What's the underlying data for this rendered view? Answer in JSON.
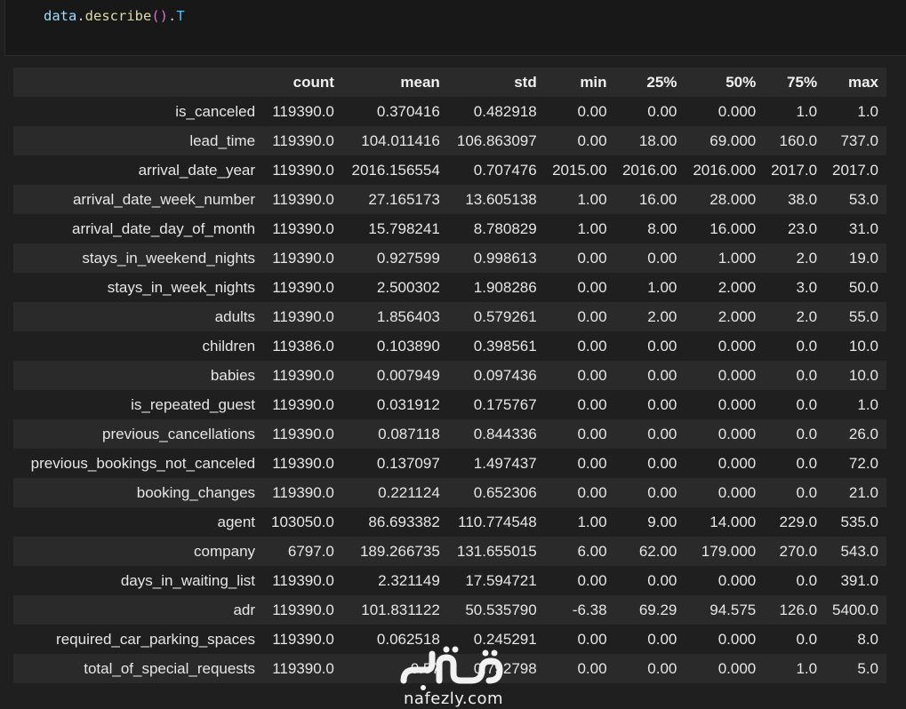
{
  "code_cell": {
    "obj": "data",
    "dot1": ".",
    "method": "describe",
    "parens": "()",
    "dot2": ".",
    "attr": "T"
  },
  "table": {
    "columns": [
      "",
      "count",
      "mean",
      "std",
      "min",
      "25%",
      "50%",
      "75%",
      "max"
    ],
    "rows": [
      [
        "is_canceled",
        "119390.0",
        "0.370416",
        "0.482918",
        "0.00",
        "0.00",
        "0.000",
        "1.0",
        "1.0"
      ],
      [
        "lead_time",
        "119390.0",
        "104.011416",
        "106.863097",
        "0.00",
        "18.00",
        "69.000",
        "160.0",
        "737.0"
      ],
      [
        "arrival_date_year",
        "119390.0",
        "2016.156554",
        "0.707476",
        "2015.00",
        "2016.00",
        "2016.000",
        "2017.0",
        "2017.0"
      ],
      [
        "arrival_date_week_number",
        "119390.0",
        "27.165173",
        "13.605138",
        "1.00",
        "16.00",
        "28.000",
        "38.0",
        "53.0"
      ],
      [
        "arrival_date_day_of_month",
        "119390.0",
        "15.798241",
        "8.780829",
        "1.00",
        "8.00",
        "16.000",
        "23.0",
        "31.0"
      ],
      [
        "stays_in_weekend_nights",
        "119390.0",
        "0.927599",
        "0.998613",
        "0.00",
        "0.00",
        "1.000",
        "2.0",
        "19.0"
      ],
      [
        "stays_in_week_nights",
        "119390.0",
        "2.500302",
        "1.908286",
        "0.00",
        "1.00",
        "2.000",
        "3.0",
        "50.0"
      ],
      [
        "adults",
        "119390.0",
        "1.856403",
        "0.579261",
        "0.00",
        "2.00",
        "2.000",
        "2.0",
        "55.0"
      ],
      [
        "children",
        "119386.0",
        "0.103890",
        "0.398561",
        "0.00",
        "0.00",
        "0.000",
        "0.0",
        "10.0"
      ],
      [
        "babies",
        "119390.0",
        "0.007949",
        "0.097436",
        "0.00",
        "0.00",
        "0.000",
        "0.0",
        "10.0"
      ],
      [
        "is_repeated_guest",
        "119390.0",
        "0.031912",
        "0.175767",
        "0.00",
        "0.00",
        "0.000",
        "0.0",
        "1.0"
      ],
      [
        "previous_cancellations",
        "119390.0",
        "0.087118",
        "0.844336",
        "0.00",
        "0.00",
        "0.000",
        "0.0",
        "26.0"
      ],
      [
        "previous_bookings_not_canceled",
        "119390.0",
        "0.137097",
        "1.497437",
        "0.00",
        "0.00",
        "0.000",
        "0.0",
        "72.0"
      ],
      [
        "booking_changes",
        "119390.0",
        "0.221124",
        "0.652306",
        "0.00",
        "0.00",
        "0.000",
        "0.0",
        "21.0"
      ],
      [
        "agent",
        "103050.0",
        "86.693382",
        "110.774548",
        "1.00",
        "9.00",
        "14.000",
        "229.0",
        "535.0"
      ],
      [
        "company",
        "6797.0",
        "189.266735",
        "131.655015",
        "6.00",
        "62.00",
        "179.000",
        "270.0",
        "543.0"
      ],
      [
        "days_in_waiting_list",
        "119390.0",
        "2.321149",
        "17.594721",
        "0.00",
        "0.00",
        "0.000",
        "0.0",
        "391.0"
      ],
      [
        "adr",
        "119390.0",
        "101.831122",
        "50.535790",
        "-6.38",
        "69.29",
        "94.575",
        "126.0",
        "5400.0"
      ],
      [
        "required_car_parking_spaces",
        "119390.0",
        "0.062518",
        "0.245291",
        "0.00",
        "0.00",
        "0.000",
        "0.0",
        "8.0"
      ],
      [
        "total_of_special_requests",
        "119390.0",
        "0.57",
        "0.792798",
        "0.00",
        "0.00",
        "0.000",
        "1.0",
        "5.0"
      ]
    ]
  },
  "watermark": {
    "text": "nafezly.com"
  }
}
